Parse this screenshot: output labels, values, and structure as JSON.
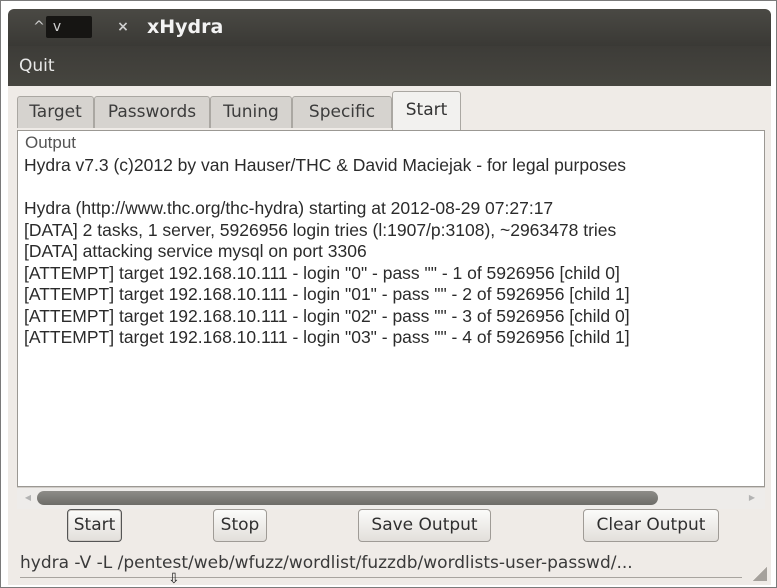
{
  "window": {
    "title": "xHydra",
    "buttons": {
      "minimize": "^",
      "maximize": "v",
      "close": "×"
    }
  },
  "menu": {
    "items": [
      "Quit"
    ]
  },
  "tabs": [
    {
      "label": "Target",
      "active": false
    },
    {
      "label": "Passwords",
      "active": false
    },
    {
      "label": "Tuning",
      "active": false
    },
    {
      "label": "Specific",
      "active": false
    },
    {
      "label": "Start",
      "active": true
    }
  ],
  "output": {
    "label": "Output",
    "lines": [
      "Hydra v7.3 (c)2012 by van Hauser/THC & David Maciejak - for legal purposes",
      "",
      "Hydra (http://www.thc.org/thc-hydra) starting at 2012-08-29 07:27:17",
      "[DATA] 2 tasks, 1 server, 5926956 login tries (l:1907/p:3108), ~2963478 tries",
      "[DATA] attacking service mysql on port 3306",
      "[ATTEMPT] target 192.168.10.111 - login \"0\" - pass \"\" - 1 of 5926956 [child 0]",
      "[ATTEMPT] target 192.168.10.111 - login \"01\" - pass \"\" - 2 of 5926956 [child 1]",
      "[ATTEMPT] target 192.168.10.111 - login \"02\" - pass \"\" - 3 of 5926956 [child 0]",
      "[ATTEMPT] target 192.168.10.111 - login \"03\" - pass \"\" - 4 of 5926956 [child 1]"
    ]
  },
  "buttons": {
    "start": "Start",
    "stop": "Stop",
    "save_output": "Save Output",
    "clear_output": "Clear Output"
  },
  "statusbar": {
    "command": "hydra -V -L /pentest/web/wfuzz/wordlist/fuzzdb/wordlists-user-passwd/..."
  }
}
